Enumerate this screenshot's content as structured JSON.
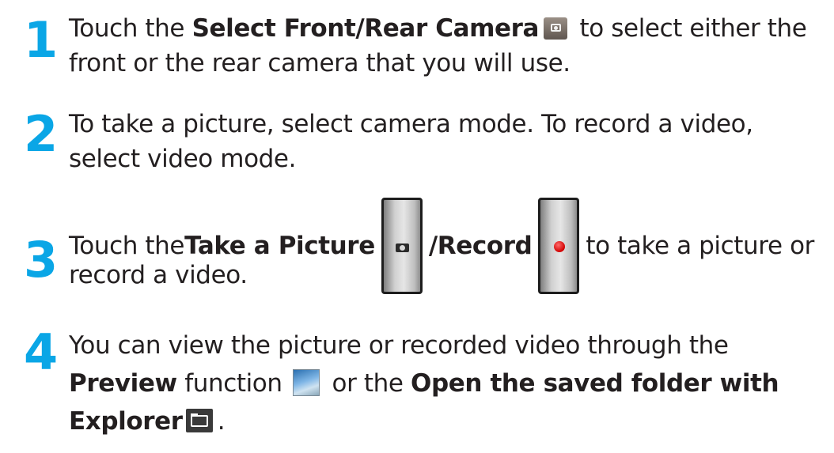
{
  "steps": [
    {
      "number": "1",
      "line1_pre": "Touch the ",
      "line1_bold": "Select Front/Rear Camera",
      "line1_post": " to select either the",
      "line2": "front or the rear camera that you will use."
    },
    {
      "number": "2",
      "line1": "To take a picture, select camera mode. To record a video,",
      "line2": "select video mode."
    },
    {
      "number": "3",
      "line1_pre": "Touch the ",
      "line1_bold1": "Take a Picture",
      "line1_bold2": "/Record",
      "line1_post": " to take a picture or",
      "line2": "record a video."
    },
    {
      "number": "4",
      "line1": "You can view the picture or recorded video through the",
      "line2_bold1": "Preview",
      "line2_mid1": " function ",
      "line2_mid2": " or the ",
      "line2_bold2": "Open the saved folder with",
      "line3_bold": "Explorer",
      "line3_post": "."
    }
  ],
  "icons": {
    "switch_camera": "camera-switch-icon",
    "take_picture": "camera-shutter-icon",
    "record": "record-icon",
    "preview": "preview-icon",
    "explorer": "folder-icon"
  },
  "colors": {
    "step_number": "#0aa6e6",
    "text": "#231f20"
  }
}
